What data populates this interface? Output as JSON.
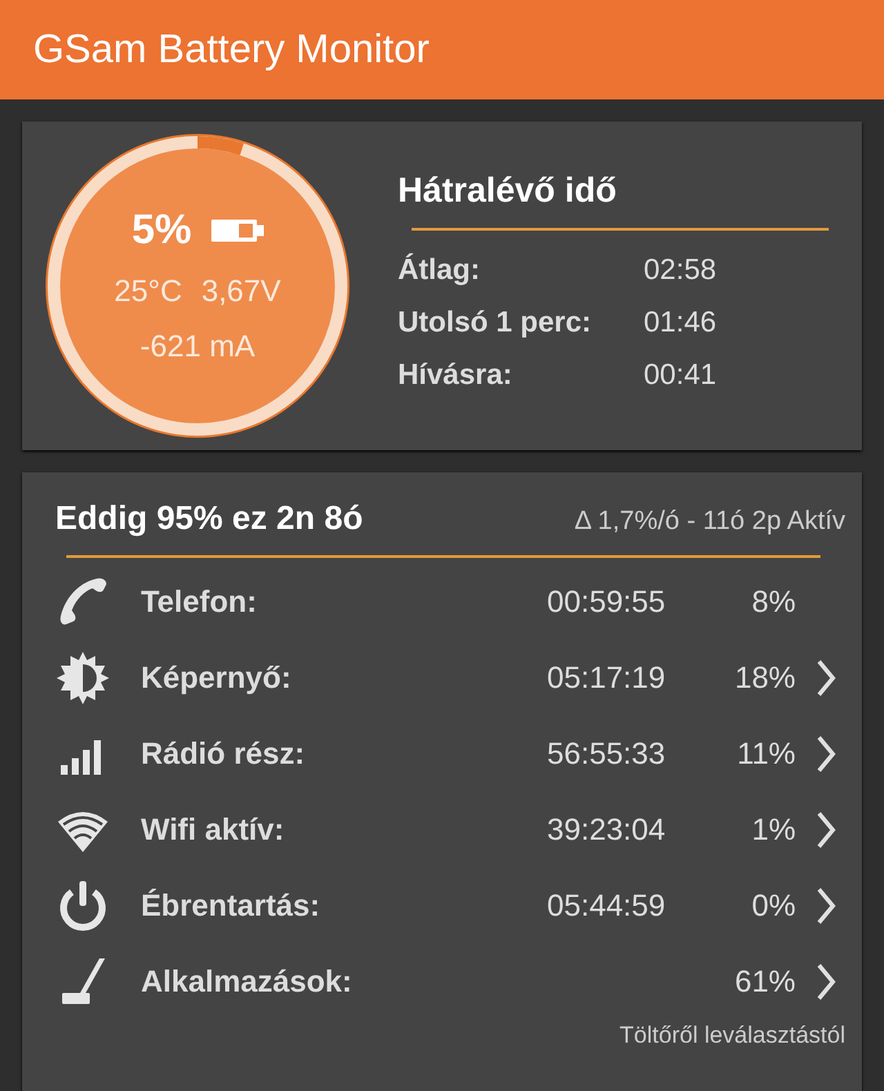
{
  "app_bar": {
    "title": "GSam Battery Monitor"
  },
  "battery": {
    "level": 0.05,
    "percent": "5%",
    "temperature": "25°C",
    "voltage": "3,67V",
    "current": "-621 mA"
  },
  "remaining": {
    "title": "Hátralévő idő",
    "rows": [
      {
        "label": "Átlag:",
        "value": "02:58"
      },
      {
        "label": "Utolsó 1 perc:",
        "value": "01:46"
      },
      {
        "label": "Hívásra:",
        "value": "00:41"
      }
    ]
  },
  "usage": {
    "title": "Eddig 95% ez 2n 8ó",
    "summary": "Δ 1,7%/ó - 11ó 2p Aktív",
    "rows": [
      {
        "kind": "phone",
        "label": "Telefon:",
        "time": "00:59:55",
        "percent": "8%",
        "has_detail": false
      },
      {
        "kind": "screen",
        "label": "Képernyő:",
        "time": "05:17:19",
        "percent": "18%",
        "has_detail": true
      },
      {
        "kind": "radio",
        "label": "Rádió rész:",
        "time": "56:55:33",
        "percent": "11%",
        "has_detail": true
      },
      {
        "kind": "wifi",
        "label": "Wifi aktív:",
        "time": "39:23:04",
        "percent": "1%",
        "has_detail": true
      },
      {
        "kind": "wakelock",
        "label": "Ébrentartás:",
        "time": "05:44:59",
        "percent": "0%",
        "has_detail": true
      },
      {
        "kind": "apps",
        "label": "Alkalmazások:",
        "percent": "61%",
        "has_detail": true
      }
    ],
    "footer": "Töltőről leválasztástól"
  }
}
